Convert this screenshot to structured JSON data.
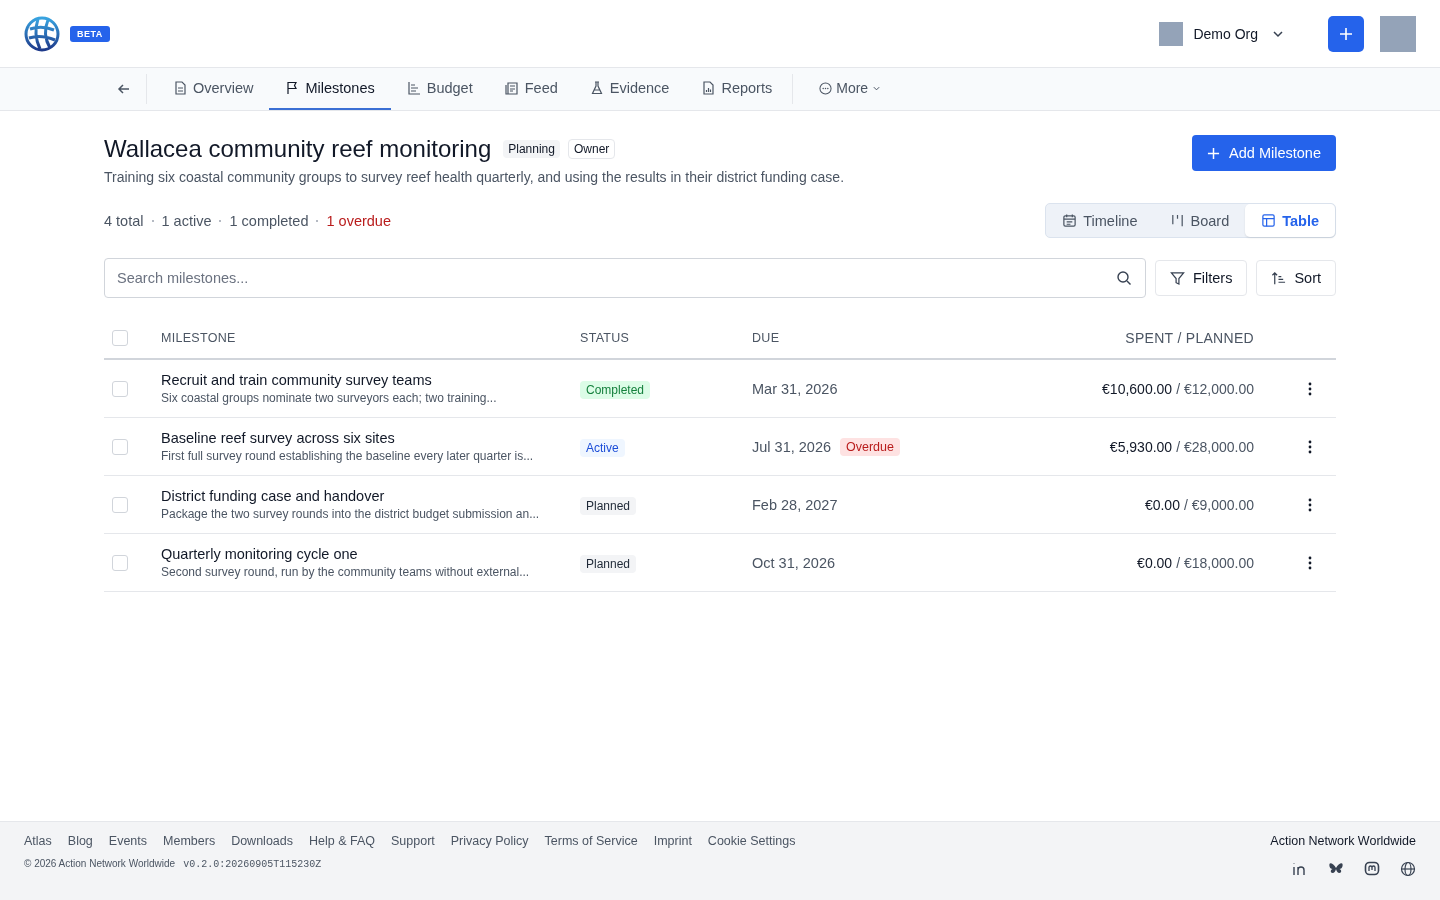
{
  "header": {
    "badge": "BETA",
    "org": "Demo Org"
  },
  "nav": {
    "tabs": [
      {
        "label": "Overview",
        "selected": false
      },
      {
        "label": "Milestones",
        "selected": true
      },
      {
        "label": "Budget",
        "selected": false
      },
      {
        "label": "Feed",
        "selected": false
      },
      {
        "label": "Evidence",
        "selected": false
      },
      {
        "label": "Reports",
        "selected": false
      }
    ],
    "more": "More"
  },
  "project": {
    "title": "Wallacea community reef monitoring",
    "tags": [
      "Planning",
      "Owner"
    ],
    "description": "Training six coastal community groups to survey reef health quarterly, and using the results in their district funding case.",
    "add_button": "Add Milestone"
  },
  "summary": [
    {
      "text": "4 total",
      "alert": false
    },
    {
      "text": "1 active",
      "alert": false
    },
    {
      "text": "1 completed",
      "alert": false
    },
    {
      "text": "1 overdue",
      "alert": true
    }
  ],
  "views": [
    {
      "label": "Timeline",
      "selected": false
    },
    {
      "label": "Board",
      "selected": false
    },
    {
      "label": "Table",
      "selected": true
    }
  ],
  "search": {
    "placeholder": "Search milestones..."
  },
  "filters_button": "Filters",
  "sort_button": "Sort",
  "table": {
    "select_all": {
      "checked": false
    },
    "columns": [
      "MILESTONE",
      "STATUS",
      "DUE",
      "SPENT / PLANNED"
    ],
    "rows": [
      {
        "checked": false,
        "title": "Recruit and train community survey teams",
        "description": "Six coastal groups nominate two surveyors each; two training...",
        "status": "Completed",
        "kind": "completed",
        "due": "Mar 31, 2026",
        "spent": "€10,600.00",
        "planned": "/ €12,000.00"
      },
      {
        "checked": false,
        "title": "Baseline reef survey across six sites",
        "description": "First full survey round establishing the baseline every later quarter is...",
        "status": "Active",
        "kind": "active",
        "due": "Jul 31, 2026",
        "flag": "Overdue",
        "spent": "€5,930.00",
        "planned": "/ €28,000.00"
      },
      {
        "checked": false,
        "title": "District funding case and handover",
        "description": "Package the two survey rounds into the district budget submission an...",
        "status": "Planned",
        "kind": "planned",
        "due": "Feb 28, 2027",
        "spent": "€0.00",
        "planned": "/ €9,000.00"
      },
      {
        "checked": false,
        "title": "Quarterly monitoring cycle one",
        "description": "Second survey round, run by the community teams without external...",
        "status": "Planned",
        "kind": "planned",
        "due": "Oct 31, 2026",
        "spent": "€0.00",
        "planned": "/ €18,000.00"
      }
    ]
  },
  "footer": {
    "links": [
      "Atlas",
      "Blog",
      "Events",
      "Members",
      "Downloads",
      "Help & FAQ",
      "Support",
      "Privacy Policy",
      "Terms of Service",
      "Imprint",
      "Cookie Settings"
    ],
    "copyright": "© 2026 Action Network Worldwide",
    "version": "v0.2.0:20260905T115230Z",
    "brand": "Action Network Worldwide"
  }
}
